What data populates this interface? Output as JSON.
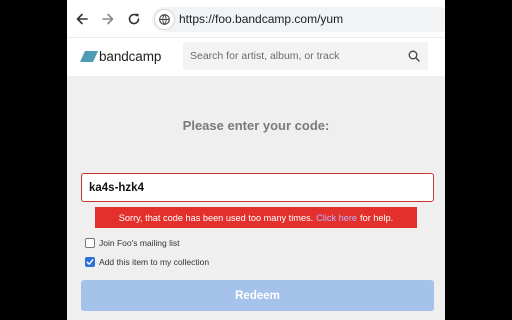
{
  "browser": {
    "url": "https://foo.bandcamp.com/yum"
  },
  "header": {
    "logo_text": "bandcamp",
    "search_placeholder": "Search for artist, album, or track"
  },
  "redeem": {
    "prompt": "Please enter your code:",
    "code_value": "ka4s-hzk4",
    "error_prefix": "Sorry, that code has been used too many times.",
    "error_link": "Click here",
    "error_suffix": "for help.",
    "mailing_list_label": "Join Foo's mailing list",
    "mailing_list_checked": false,
    "collection_label": "Add this item to my collection",
    "collection_checked": true,
    "button_label": "Redeem"
  },
  "colors": {
    "error_red": "#e3302d",
    "input_border": "#c8372d",
    "button_blue": "#a5c2ea",
    "logo_blue": "#4e9bb6"
  },
  "icons": [
    "arrow-back-icon",
    "arrow-forward-icon",
    "reload-icon",
    "site-info-icon",
    "search-icon",
    "check-icon"
  ]
}
